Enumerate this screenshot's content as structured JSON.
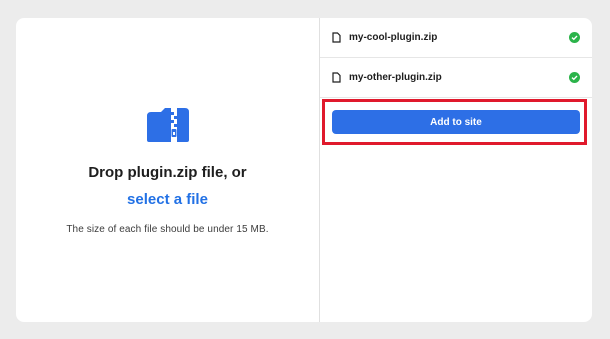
{
  "dropzone": {
    "icon": "zip-folder-icon",
    "title": "Drop plugin.zip file, or",
    "select_link": "select a file",
    "hint": "The size of each file should be under 15 MB."
  },
  "files": [
    {
      "name": "my-cool-plugin.zip",
      "icon": "file-icon",
      "status": "check-circle-icon"
    },
    {
      "name": "my-other-plugin.zip",
      "icon": "file-icon",
      "status": "check-circle-icon"
    }
  ],
  "actions": {
    "add_label": "Add to site"
  },
  "colors": {
    "accent": "#2d6fe6",
    "link": "#2271e5",
    "success": "#2bb34a",
    "highlight": "#e0192c",
    "background": "#ececec"
  }
}
